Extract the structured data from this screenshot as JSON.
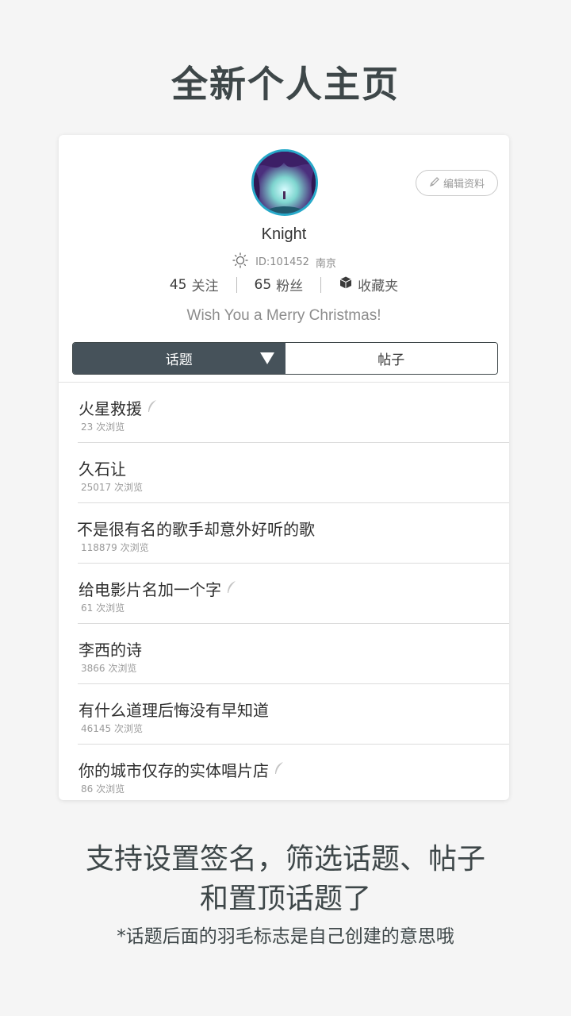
{
  "headline": "全新个人主页",
  "profile": {
    "edit_label": "编辑资料",
    "username": "Knight",
    "id_text": "ID:101452",
    "location": "南京",
    "following_count": "45",
    "following_label": "关注",
    "followers_count": "65",
    "followers_label": "粉丝",
    "favorites_label": "收藏夹",
    "signature": "Wish You a Merry Christmas!"
  },
  "tabs": [
    {
      "label": "话题",
      "active": true
    },
    {
      "label": "帖子",
      "active": false
    }
  ],
  "topics": [
    {
      "title": "火星救援",
      "views": "23 次浏览",
      "own": true
    },
    {
      "title": "久石让",
      "views": "25017 次浏览",
      "own": false
    },
    {
      "title": "不是很有名的歌手却意外好听的歌",
      "views": "118879 次浏览",
      "own": false
    },
    {
      "title": "给电影片名加一个字",
      "views": "61 次浏览",
      "own": true
    },
    {
      "title": "李西的诗",
      "views": "3866 次浏览",
      "own": false
    },
    {
      "title": "有什么道理后悔没有早知道",
      "views": "46145 次浏览",
      "own": false
    },
    {
      "title": "你的城市仅存的实体唱片店",
      "views": "86 次浏览",
      "own": true
    }
  ],
  "caption": {
    "line1": "支持设置签名，筛选话题、帖子",
    "line2": "和置顶话题了",
    "footnote": "*话题后面的羽毛标志是自己创建的意思哦"
  },
  "icons": {
    "edit": "pencil-icon",
    "weather": "sun-icon",
    "favorites": "box-icon",
    "own_topic": "feather-icon",
    "tab_dropdown": "triangle-down-icon"
  },
  "colors": {
    "active_tab": "#46525a",
    "avatar_ring": "#27a9c9",
    "background": "#f5f5f5"
  }
}
